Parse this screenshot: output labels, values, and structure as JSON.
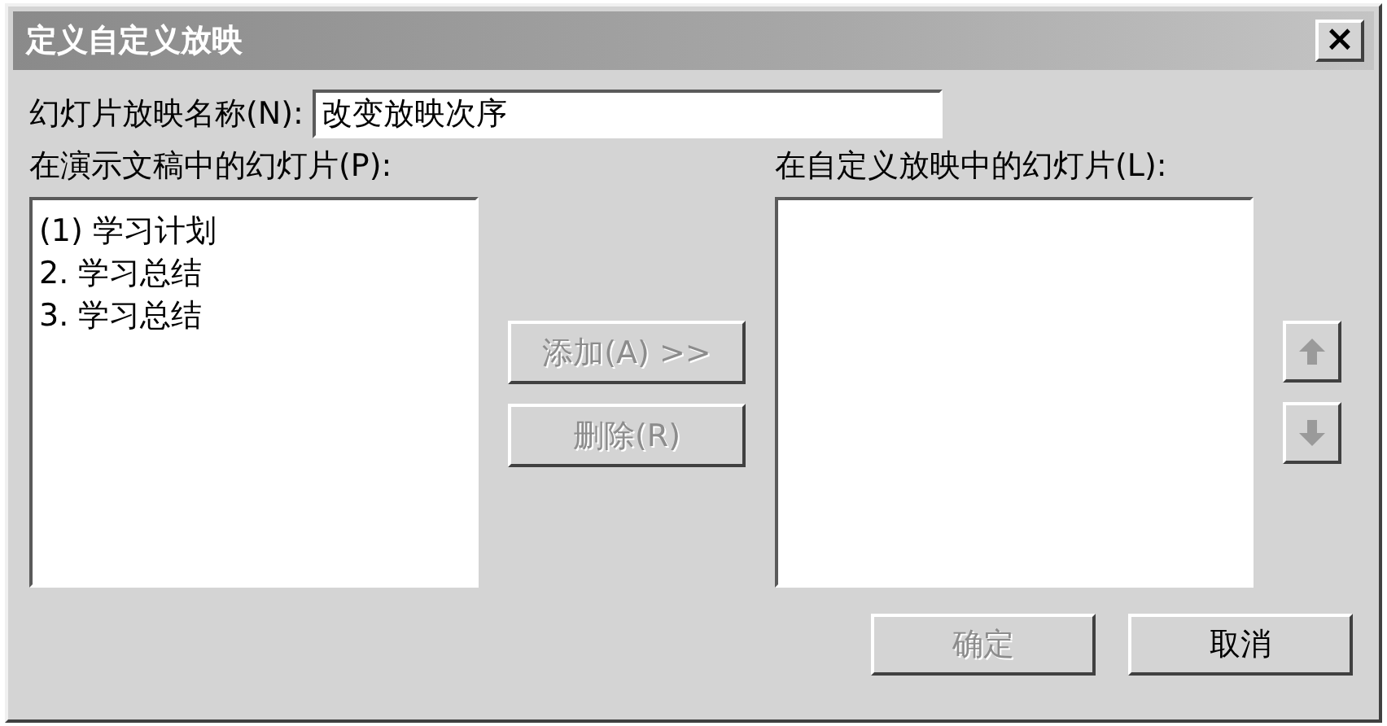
{
  "window": {
    "title": "定义自定义放映",
    "close": "×"
  },
  "name_field": {
    "label": "幻灯片放映名称(N):",
    "value": "改变放映次序"
  },
  "presentation_slides": {
    "label": "在演示文稿中的幻灯片(P):",
    "items": [
      {
        "text": "(1) 学习计划",
        "selected": false
      },
      {
        "text": "2.  学习总结",
        "selected": false
      },
      {
        "text": "3.  学习总结",
        "selected": false
      }
    ]
  },
  "move_buttons": [
    {
      "label": "添加(A) >>",
      "disabled": true
    },
    {
      "label": "删除(R)",
      "disabled": true
    }
  ],
  "custom_slides": {
    "label": "在自定义放映中的幻灯片(L):"
  },
  "order_buttons": [
    {
      "kind": "up",
      "disabled": true
    },
    {
      "kind": "down",
      "disabled": true
    }
  ],
  "footer_buttons": [
    {
      "label": "确定",
      "disabled": true
    },
    {
      "label": "取消",
      "disabled": false
    }
  ]
}
